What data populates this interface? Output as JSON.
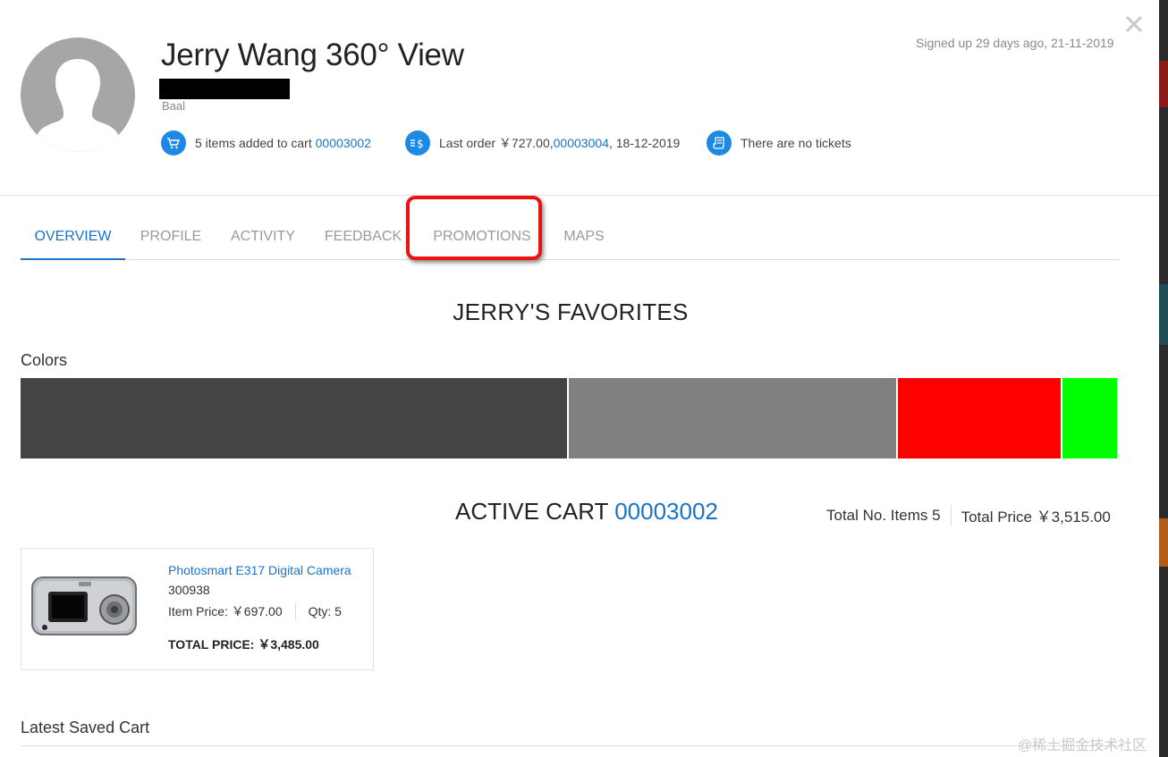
{
  "header": {
    "title": "Jerry Wang 360° View",
    "subtitle": "Baal",
    "signed_up": "Signed up 29 days ago, 21-11-2019"
  },
  "stats": {
    "cart_text": "5 items added to cart",
    "cart_link": "00003002",
    "order_text": "Last order ￥727.00, ",
    "order_link": "00003004",
    "order_date": ", 18-12-2019",
    "tickets_text": "There are no tickets"
  },
  "tabs": [
    {
      "label": "OVERVIEW",
      "active": true
    },
    {
      "label": "PROFILE",
      "active": false
    },
    {
      "label": "ACTIVITY",
      "active": false
    },
    {
      "label": "FEEDBACK",
      "active": false
    },
    {
      "label": "PROMOTIONS",
      "active": false
    },
    {
      "label": "MAPS",
      "active": false
    }
  ],
  "favorites": {
    "title": "JERRY'S FAVORITES",
    "colors_label": "Colors",
    "colors": [
      {
        "color": "#444444",
        "share": 0.5
      },
      {
        "color": "#808080",
        "share": 0.3
      },
      {
        "color": "#ff0000",
        "share": 0.15
      },
      {
        "color": "#00ff00",
        "share": 0.05
      }
    ]
  },
  "cart": {
    "title": "ACTIVE CART",
    "number": "00003002",
    "total_items": "Total No. Items 5",
    "total_price": "Total Price ￥3,515.00",
    "item": {
      "name": "Photosmart E317 Digital Camera",
      "code": "300938",
      "item_price": "Item Price:  ￥697.00",
      "qty": "Qty: 5",
      "total": "TOTAL PRICE:  ￥3,485.00"
    }
  },
  "saved": {
    "label": "Latest Saved Cart"
  },
  "watermark": "@稀土掘金技术社区",
  "theme": {
    "accent": "#1a73c9",
    "icon_bg": "#1e88e5",
    "highlight": "#ee1111"
  }
}
